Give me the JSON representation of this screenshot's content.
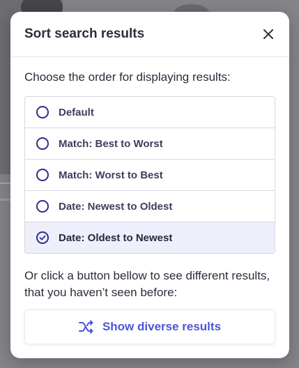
{
  "modal": {
    "title": "Sort search results",
    "close_icon": "close-icon",
    "prompt": "Choose the order for displaying results:",
    "options": [
      {
        "label": "Default",
        "selected": false
      },
      {
        "label": "Match: Best to Worst",
        "selected": false
      },
      {
        "label": "Match: Worst to Best",
        "selected": false
      },
      {
        "label": "Date: Newest to Oldest",
        "selected": false
      },
      {
        "label": "Date: Oldest to Newest",
        "selected": true
      }
    ],
    "hint": "Or click a button bellow to see different results, that you haven’t seen before:",
    "diverse_button": {
      "label": "Show diverse results",
      "icon": "shuffle-icon"
    }
  },
  "colors": {
    "accent": "#4a55d6",
    "radio": "#2b2e8c",
    "selected_bg": "#eeeffb",
    "text": "#2b2d3b"
  }
}
